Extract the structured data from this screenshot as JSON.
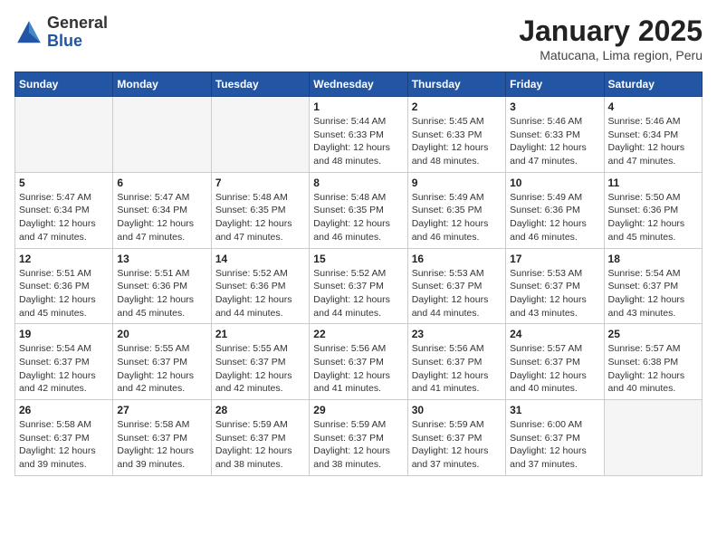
{
  "header": {
    "logo_general": "General",
    "logo_blue": "Blue",
    "month_title": "January 2025",
    "location": "Matucana, Lima region, Peru"
  },
  "weekdays": [
    "Sunday",
    "Monday",
    "Tuesday",
    "Wednesday",
    "Thursday",
    "Friday",
    "Saturday"
  ],
  "weeks": [
    [
      {
        "day": "",
        "empty": true
      },
      {
        "day": "",
        "empty": true
      },
      {
        "day": "",
        "empty": true
      },
      {
        "day": "1",
        "sunrise": "5:44 AM",
        "sunset": "6:33 PM",
        "daylight": "12 hours and 48 minutes."
      },
      {
        "day": "2",
        "sunrise": "5:45 AM",
        "sunset": "6:33 PM",
        "daylight": "12 hours and 48 minutes."
      },
      {
        "day": "3",
        "sunrise": "5:46 AM",
        "sunset": "6:33 PM",
        "daylight": "12 hours and 47 minutes."
      },
      {
        "day": "4",
        "sunrise": "5:46 AM",
        "sunset": "6:34 PM",
        "daylight": "12 hours and 47 minutes."
      }
    ],
    [
      {
        "day": "5",
        "sunrise": "5:47 AM",
        "sunset": "6:34 PM",
        "daylight": "12 hours and 47 minutes."
      },
      {
        "day": "6",
        "sunrise": "5:47 AM",
        "sunset": "6:34 PM",
        "daylight": "12 hours and 47 minutes."
      },
      {
        "day": "7",
        "sunrise": "5:48 AM",
        "sunset": "6:35 PM",
        "daylight": "12 hours and 47 minutes."
      },
      {
        "day": "8",
        "sunrise": "5:48 AM",
        "sunset": "6:35 PM",
        "daylight": "12 hours and 46 minutes."
      },
      {
        "day": "9",
        "sunrise": "5:49 AM",
        "sunset": "6:35 PM",
        "daylight": "12 hours and 46 minutes."
      },
      {
        "day": "10",
        "sunrise": "5:49 AM",
        "sunset": "6:36 PM",
        "daylight": "12 hours and 46 minutes."
      },
      {
        "day": "11",
        "sunrise": "5:50 AM",
        "sunset": "6:36 PM",
        "daylight": "12 hours and 45 minutes."
      }
    ],
    [
      {
        "day": "12",
        "sunrise": "5:51 AM",
        "sunset": "6:36 PM",
        "daylight": "12 hours and 45 minutes."
      },
      {
        "day": "13",
        "sunrise": "5:51 AM",
        "sunset": "6:36 PM",
        "daylight": "12 hours and 45 minutes."
      },
      {
        "day": "14",
        "sunrise": "5:52 AM",
        "sunset": "6:36 PM",
        "daylight": "12 hours and 44 minutes."
      },
      {
        "day": "15",
        "sunrise": "5:52 AM",
        "sunset": "6:37 PM",
        "daylight": "12 hours and 44 minutes."
      },
      {
        "day": "16",
        "sunrise": "5:53 AM",
        "sunset": "6:37 PM",
        "daylight": "12 hours and 44 minutes."
      },
      {
        "day": "17",
        "sunrise": "5:53 AM",
        "sunset": "6:37 PM",
        "daylight": "12 hours and 43 minutes."
      },
      {
        "day": "18",
        "sunrise": "5:54 AM",
        "sunset": "6:37 PM",
        "daylight": "12 hours and 43 minutes."
      }
    ],
    [
      {
        "day": "19",
        "sunrise": "5:54 AM",
        "sunset": "6:37 PM",
        "daylight": "12 hours and 42 minutes."
      },
      {
        "day": "20",
        "sunrise": "5:55 AM",
        "sunset": "6:37 PM",
        "daylight": "12 hours and 42 minutes."
      },
      {
        "day": "21",
        "sunrise": "5:55 AM",
        "sunset": "6:37 PM",
        "daylight": "12 hours and 42 minutes."
      },
      {
        "day": "22",
        "sunrise": "5:56 AM",
        "sunset": "6:37 PM",
        "daylight": "12 hours and 41 minutes."
      },
      {
        "day": "23",
        "sunrise": "5:56 AM",
        "sunset": "6:37 PM",
        "daylight": "12 hours and 41 minutes."
      },
      {
        "day": "24",
        "sunrise": "5:57 AM",
        "sunset": "6:37 PM",
        "daylight": "12 hours and 40 minutes."
      },
      {
        "day": "25",
        "sunrise": "5:57 AM",
        "sunset": "6:38 PM",
        "daylight": "12 hours and 40 minutes."
      }
    ],
    [
      {
        "day": "26",
        "sunrise": "5:58 AM",
        "sunset": "6:37 PM",
        "daylight": "12 hours and 39 minutes."
      },
      {
        "day": "27",
        "sunrise": "5:58 AM",
        "sunset": "6:37 PM",
        "daylight": "12 hours and 39 minutes."
      },
      {
        "day": "28",
        "sunrise": "5:59 AM",
        "sunset": "6:37 PM",
        "daylight": "12 hours and 38 minutes."
      },
      {
        "day": "29",
        "sunrise": "5:59 AM",
        "sunset": "6:37 PM",
        "daylight": "12 hours and 38 minutes."
      },
      {
        "day": "30",
        "sunrise": "5:59 AM",
        "sunset": "6:37 PM",
        "daylight": "12 hours and 37 minutes."
      },
      {
        "day": "31",
        "sunrise": "6:00 AM",
        "sunset": "6:37 PM",
        "daylight": "12 hours and 37 minutes."
      },
      {
        "day": "",
        "empty": true
      }
    ]
  ]
}
